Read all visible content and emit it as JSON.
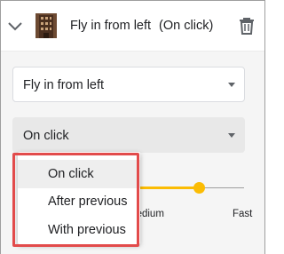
{
  "header": {
    "title": "Fly in from left",
    "subtitle": "(On click)",
    "expand_icon": "chevron-down-icon",
    "thumbnail_icon": "building-thumbnail-icon",
    "delete_icon": "trash-icon"
  },
  "effect_select": {
    "value": "Fly in from left"
  },
  "start_select": {
    "value": "On click"
  },
  "speed": {
    "slow_label": "Medium",
    "fast_label": "Fast",
    "level": 0.75
  },
  "start_menu": {
    "options": [
      "On click",
      "After previous",
      "With previous"
    ],
    "selected": "On click"
  },
  "colors": {
    "accent": "#fbbc04",
    "highlight_box": "#e24b4b",
    "panel_background": "#f5f5f5"
  }
}
